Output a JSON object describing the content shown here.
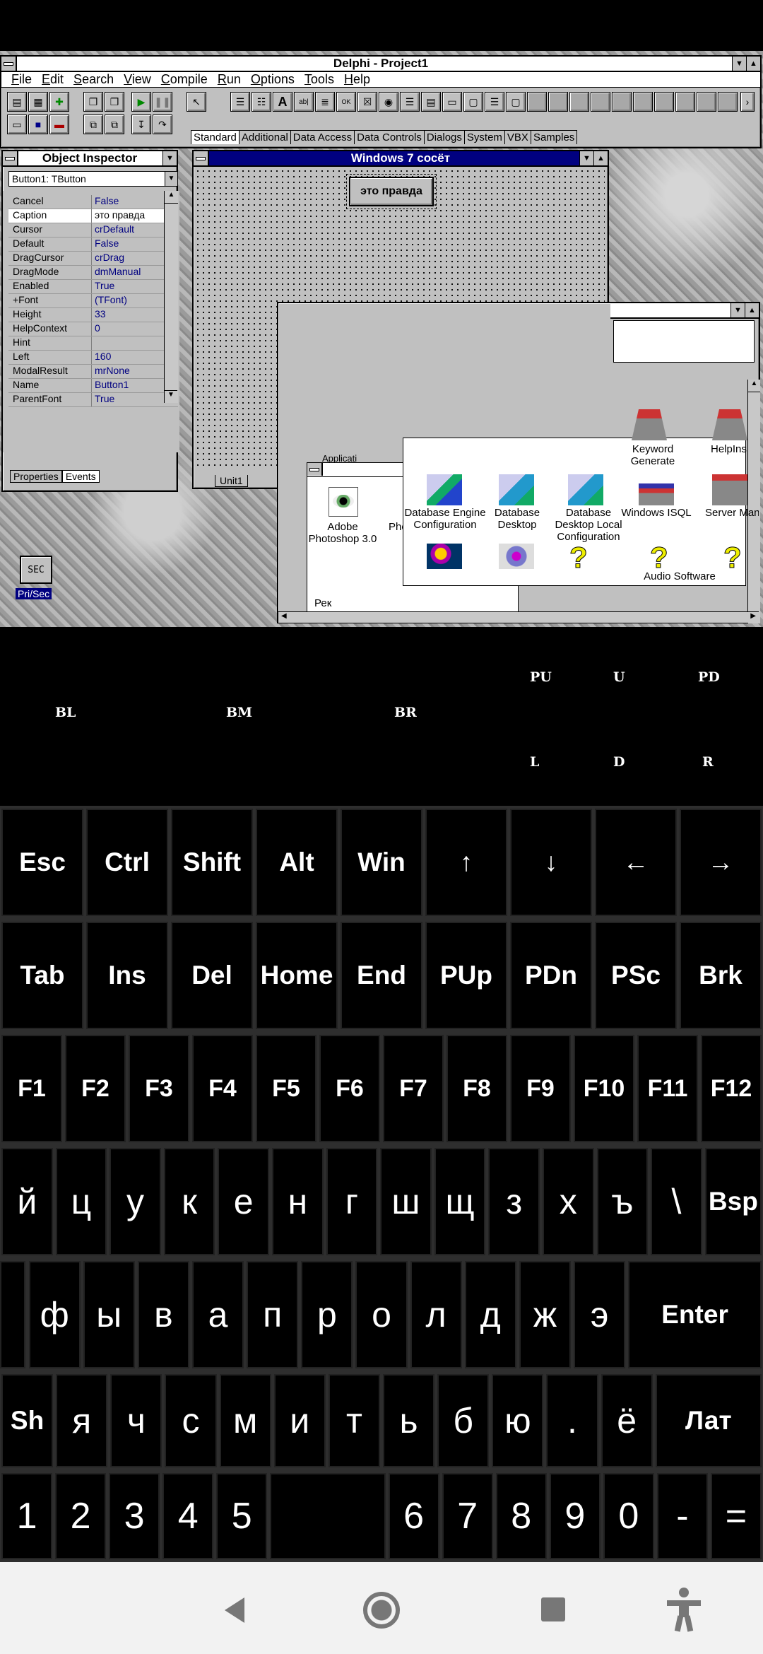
{
  "delphi": {
    "title": "Delphi - Project1",
    "menu": [
      "File",
      "Edit",
      "Search",
      "View",
      "Compile",
      "Run",
      "Options",
      "Tools",
      "Help"
    ],
    "palette_tabs": [
      "Standard",
      "Additional",
      "Data Access",
      "Data Controls",
      "Dialogs",
      "System",
      "VBX",
      "Samples"
    ]
  },
  "inspector": {
    "title": "Object Inspector",
    "selector": "Button1: TButton",
    "properties": [
      {
        "name": "Cancel",
        "value": "False"
      },
      {
        "name": "Caption",
        "value": "это правда"
      },
      {
        "name": "Cursor",
        "value": "crDefault"
      },
      {
        "name": "Default",
        "value": "False"
      },
      {
        "name": "DragCursor",
        "value": "crDrag"
      },
      {
        "name": "DragMode",
        "value": "dmManual"
      },
      {
        "name": "Enabled",
        "value": "True"
      },
      {
        "name": "+Font",
        "value": "(TFont)"
      },
      {
        "name": "Height",
        "value": "33"
      },
      {
        "name": "HelpContext",
        "value": "0"
      },
      {
        "name": "Hint",
        "value": ""
      },
      {
        "name": "Left",
        "value": "160"
      },
      {
        "name": "ModalResult",
        "value": "mrNone"
      },
      {
        "name": "Name",
        "value": "Button1"
      },
      {
        "name": "ParentFont",
        "value": "True"
      }
    ],
    "tabs": [
      "Properties",
      "Events"
    ]
  },
  "form": {
    "title": "Windows 7 сосёт",
    "button_caption": "это правда",
    "editor_tab": "Unit1"
  },
  "desktop_icons": {
    "sec_label": "SEC",
    "sec_caption": "Pri/Sec",
    "photoshop": "Adobe Photoshop 3.0",
    "pho_partial": "Pho",
    "app_partial": "Applicati",
    "rek_partial": "Рек",
    "group": [
      "Keyword Generate",
      "HelpIns",
      "Database Engine Configuration",
      "Database Desktop",
      "Database Desktop Local Configuration",
      "Windows ISQL",
      "Server Manage"
    ],
    "audio": "Audio Software"
  },
  "arrow_labels": {
    "bl": "BL",
    "bm": "BM",
    "br": "BR",
    "pu": "PU",
    "u": "U",
    "pd": "PD",
    "l": "L",
    "d": "D",
    "r": "R"
  },
  "keyboard": {
    "row1": [
      "Esc",
      "Ctrl",
      "Shift",
      "Alt",
      "Win",
      "↑",
      "↓",
      "←",
      "→"
    ],
    "row2": [
      "Tab",
      "Ins",
      "Del",
      "Home",
      "End",
      "PUp",
      "PDn",
      "PSc",
      "Brk"
    ],
    "row3": [
      "F1",
      "F2",
      "F3",
      "F4",
      "F5",
      "F6",
      "F7",
      "F8",
      "F9",
      "F10",
      "F11",
      "F12"
    ],
    "row4": [
      "й",
      "ц",
      "у",
      "к",
      "е",
      "н",
      "г",
      "ш",
      "щ",
      "з",
      "х",
      "ъ",
      "\\",
      "Bsp"
    ],
    "row5": [
      "ф",
      "ы",
      "в",
      "а",
      "п",
      "р",
      "о",
      "л",
      "д",
      "ж",
      "э",
      "Enter"
    ],
    "row6": [
      "Sh",
      "я",
      "ч",
      "с",
      "м",
      "и",
      "т",
      "ь",
      "б",
      "ю",
      ".",
      "ё",
      "Лат"
    ],
    "row7": [
      "1",
      "2",
      "3",
      "4",
      "5",
      "",
      "6",
      "7",
      "8",
      "9",
      "0",
      "-",
      "="
    ]
  }
}
